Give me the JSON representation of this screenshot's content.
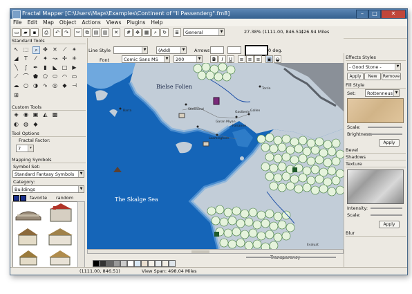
{
  "titlebar": {
    "title": "Fractal Mapper [C:\\Users\\Maps\\Examples\\Continent of \"Il Passenderg\".fm8]"
  },
  "menu": [
    "File",
    "Edit",
    "Map",
    "Object",
    "Actions",
    "Views",
    "Plugins",
    "Help"
  ],
  "toolbar": {
    "layer_select": "General",
    "zoom": "27.38% (1111.00, 846.51)",
    "scale": "426.94 Miles"
  },
  "style_bar": {
    "line_style_label": "Line Style",
    "line_weight": "(Add)",
    "arrows_label": "Arrows:",
    "angle": "0 deg.",
    "font_label": "Font",
    "font_name": "Comic Sans MS",
    "font_size": "200",
    "bold": "B",
    "italic": "I",
    "underline": "U"
  },
  "left_panel": {
    "standard_tools": "Standard Tools",
    "custom_tools": "Custom Tools",
    "tool_options": "Tool Options",
    "fractal_factor_label": "Fractal Factor:",
    "fractal_factor_value": "7",
    "mapping_symbols": "Mapping Symbols",
    "symbol_set_label": "Symbol Set:",
    "symbol_set_value": "Standard Fantasy Symbols",
    "category_label": "Category:",
    "category_value": "Buildings",
    "favorite": "favorite",
    "random": "random"
  },
  "right_panel": {
    "effects_styles": "Effects Styles",
    "effects_combo": "- Good Stone -",
    "apply": "Apply",
    "new": "New",
    "remove": "Remove",
    "fill_style": "Fill Style",
    "set_label": "Set:",
    "set_value": "Rottenneus",
    "scale_label": "Scale:",
    "brightness_label": "Brightness:",
    "bevel": "Bevel",
    "shadows": "Shadows",
    "texture": "Texture",
    "intensity_label": "Intensity:",
    "apply_texture": "Apply",
    "blur": "Blur"
  },
  "map": {
    "sea_label": "The Skalge Sea",
    "town_top": "Bielse Folien",
    "places": [
      "Stielmond",
      "Loaminghorn",
      "Garan Miyan",
      "Gaolberin",
      "Gallen",
      "Barra",
      "Torrin",
      "Folsanne",
      "Evaluat"
    ]
  },
  "bottom": {
    "transparency_label": "Transparency"
  },
  "status": {
    "coords": "(1111.00, 846.51)",
    "viewspan": "View Span: 498.04 Miles"
  },
  "colors": {
    "sea": "#1565b8",
    "land": "#c2cdd8",
    "forest_fill": "#e5f3dc",
    "forest_stroke": "#3d7a38"
  }
}
